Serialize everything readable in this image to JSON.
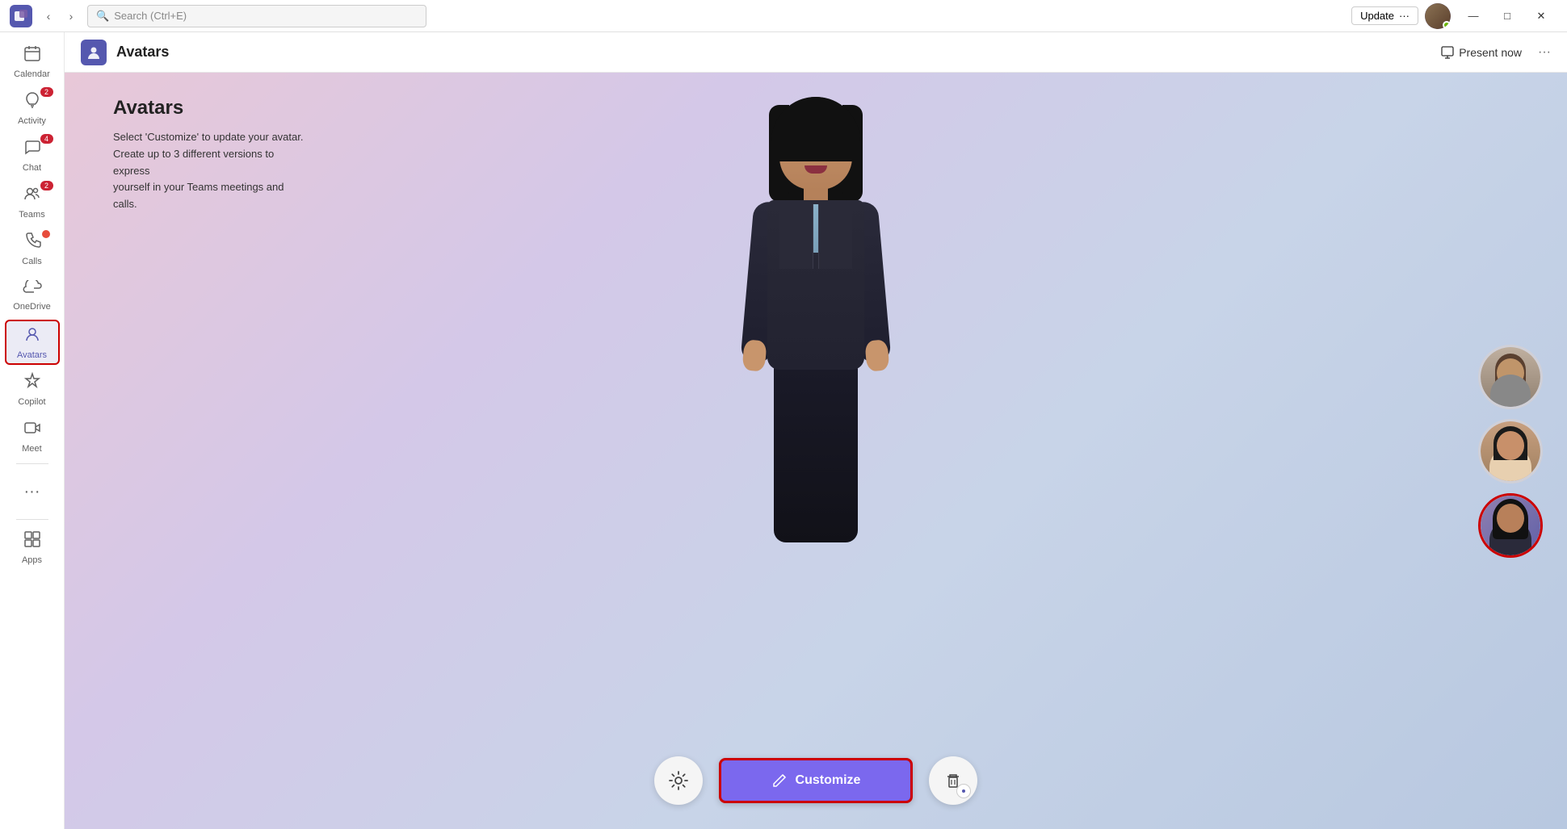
{
  "titlebar": {
    "teams_logo": "T",
    "search_placeholder": "Search (Ctrl+E)",
    "update_label": "Update",
    "more_label": "···",
    "minimize": "—",
    "maximize": "□",
    "close": "✕"
  },
  "sidebar": {
    "items": [
      {
        "id": "calendar",
        "label": "Calendar",
        "icon": "📅",
        "badge": null
      },
      {
        "id": "activity",
        "label": "Activity",
        "icon": "🔔",
        "badge": "2"
      },
      {
        "id": "chat",
        "label": "Chat",
        "icon": "💬",
        "badge": "4"
      },
      {
        "id": "teams",
        "label": "Teams",
        "icon": "👥",
        "badge": "2"
      },
      {
        "id": "calls",
        "label": "Calls",
        "icon": "📞",
        "badge_dot": true
      },
      {
        "id": "onedrive",
        "label": "OneDrive",
        "icon": "☁",
        "badge": null
      },
      {
        "id": "avatars",
        "label": "Avatars",
        "icon": "👤",
        "badge": null,
        "active": true
      },
      {
        "id": "copilot",
        "label": "Copilot",
        "icon": "✦",
        "badge": null
      },
      {
        "id": "meet",
        "label": "Meet",
        "icon": "🎥",
        "badge": null
      },
      {
        "id": "apps",
        "label": "Apps",
        "icon": "⊞",
        "badge": null
      }
    ],
    "more_label": "···"
  },
  "app_header": {
    "icon": "👤",
    "title": "Avatars",
    "present_label": "Present now",
    "more": "···"
  },
  "content": {
    "title": "Avatars",
    "description_line1": "Select 'Customize' to update your avatar.",
    "description_line2": "Create up to 3 different versions to express",
    "description_line3": "yourself in your Teams meetings and calls.",
    "customize_label": "Customize",
    "pencil_icon": "✏",
    "trash_icon": "🗑",
    "settings_icon": "⚙"
  },
  "thumbnails": [
    {
      "id": "thumb1",
      "selected": false
    },
    {
      "id": "thumb2",
      "selected": false
    },
    {
      "id": "thumb3",
      "selected": true
    }
  ],
  "colors": {
    "sidebar_active_bg": "#ebebf5",
    "sidebar_active_color": "#5558af",
    "customize_bg": "#7b68ee",
    "customize_border": "#cc0000",
    "badge_bg": "#cc2233",
    "teams_brand": "#5558af"
  }
}
